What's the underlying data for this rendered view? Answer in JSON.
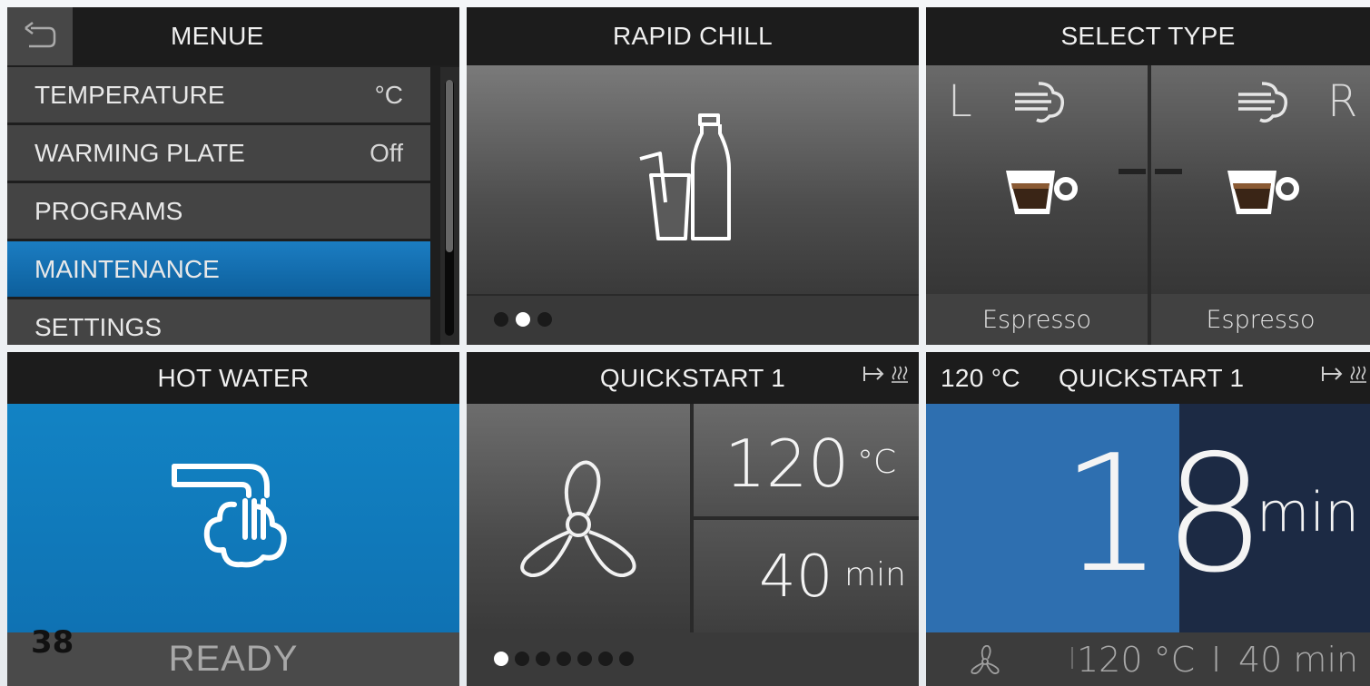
{
  "menu_panel": {
    "title": "MENUE",
    "back_icon": "back-arrow-icon",
    "items": [
      {
        "label": "TEMPERATURE",
        "value": "°C",
        "selected": false
      },
      {
        "label": "WARMING PLATE",
        "value": "Off",
        "selected": false
      },
      {
        "label": "PROGRAMS",
        "value": "",
        "selected": false
      },
      {
        "label": "MAINTENANCE",
        "value": "",
        "selected": true
      },
      {
        "label": "SETTINGS",
        "value": "",
        "selected": false
      }
    ]
  },
  "rapid_chill_panel": {
    "title": "RAPID CHILL",
    "icon": "glass-and-bottle-icon",
    "page_dots": 3,
    "active_dot": 1
  },
  "select_type_panel": {
    "title": "SELECT TYPE",
    "left_letter": "L",
    "right_letter": "R",
    "left_label": "Espresso",
    "right_label": "Espresso",
    "icons": [
      "steam-icon",
      "espresso-cup-icon"
    ]
  },
  "hot_water_panel": {
    "title": "HOT WATER",
    "icon": "faucet-water-icon",
    "status": "READY"
  },
  "quickstart_panel": {
    "title": "QUICKSTART 1",
    "temperature": "120",
    "temperature_unit": "°C",
    "duration": "40",
    "duration_unit": "min",
    "icon": "fan-icon",
    "page_dots": 7,
    "active_dot": 0
  },
  "quickstart_running_panel": {
    "temperature": "120 °C",
    "title": "QUICKSTART 1",
    "remaining": "18",
    "remaining_unit": "min",
    "footer_temp": "120 °C",
    "footer_sep": "I",
    "footer_time": "40 min",
    "progress_fraction": 0.57
  },
  "page_number": "38",
  "colors": {
    "accent_blue": "#1283c4",
    "selected_blue": "#1b7dc2",
    "header_dark": "#1c1c1c"
  }
}
